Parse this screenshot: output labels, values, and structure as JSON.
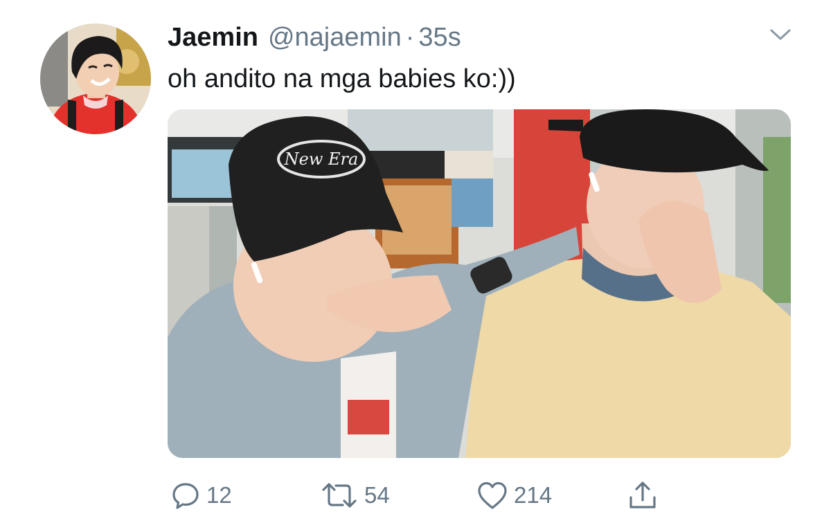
{
  "tweet": {
    "author": {
      "display_name": "Jaemin",
      "handle": "@najaemin",
      "separator": "·",
      "timestamp": "35s",
      "avatar_icon": "profile-photo"
    },
    "text": "oh andito na mga babies ko:))",
    "media": {
      "type": "photo",
      "visible_text": [
        "New Era"
      ]
    },
    "actions": {
      "reply": {
        "icon": "reply-icon",
        "count": "12"
      },
      "retweet": {
        "icon": "retweet-icon",
        "count": "54"
      },
      "like": {
        "icon": "heart-icon",
        "count": "214"
      },
      "share": {
        "icon": "share-icon"
      }
    },
    "menu_icon": "chevron-down-icon"
  },
  "colors": {
    "text_primary": "#14171a",
    "text_secondary": "#657786",
    "background": "#ffffff"
  }
}
